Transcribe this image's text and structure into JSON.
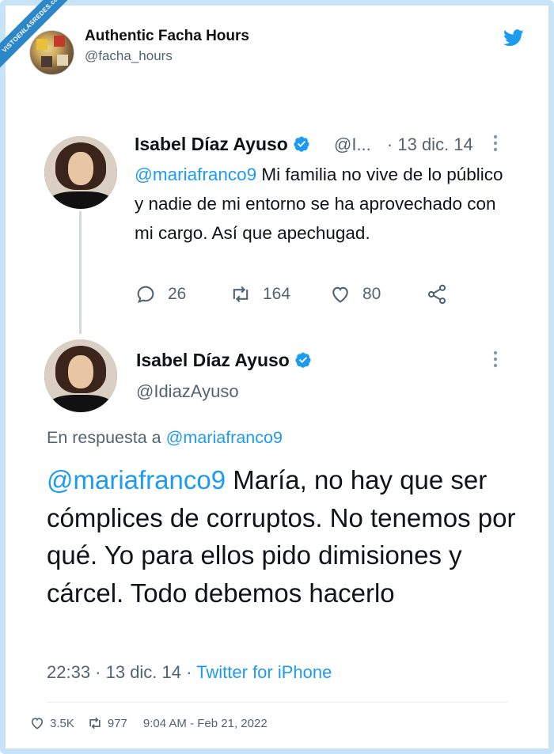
{
  "watermark": {
    "text": "VISTOENLASREDES",
    "sub": ".com"
  },
  "outer_tweet": {
    "name": "Authentic Facha Hours",
    "handle": "@facha_hours",
    "icon": "twitter-bird-icon",
    "likes": "3.5K",
    "retweets": "977",
    "timestamp": "9:04 AM - Feb 21, 2022"
  },
  "tweet1": {
    "name": "Isabel Díaz Ayuso",
    "handle_short": "@I...",
    "date": "· 13 dic. 14",
    "mention": "@mariafranco9",
    "text": " Mi familia no vive de lo público y nadie de mi entorno se ha aprovechado con mi cargo. Así que apechugad.",
    "replies": "26",
    "retweets": "164",
    "likes": "80"
  },
  "tweet2": {
    "name": "Isabel Díaz Ayuso",
    "handle": "@IdiazAyuso",
    "reply_prefix": "En respuesta a ",
    "reply_mention": "@mariafranco9",
    "mention": "@mariafranco9",
    "text": " María, no hay que ser cómplices de corruptos. No tenemos por qué. Yo para ellos pido dimisiones y cárcel. Todo debemos hacerlo",
    "time": "22:33 · 13 dic. 14 · ",
    "source": "Twitter for iPhone"
  },
  "colors": {
    "accent": "#1d9bf0",
    "muted": "#536471",
    "frame": "#c6e4f5",
    "ribbon": "#2c87c8"
  }
}
